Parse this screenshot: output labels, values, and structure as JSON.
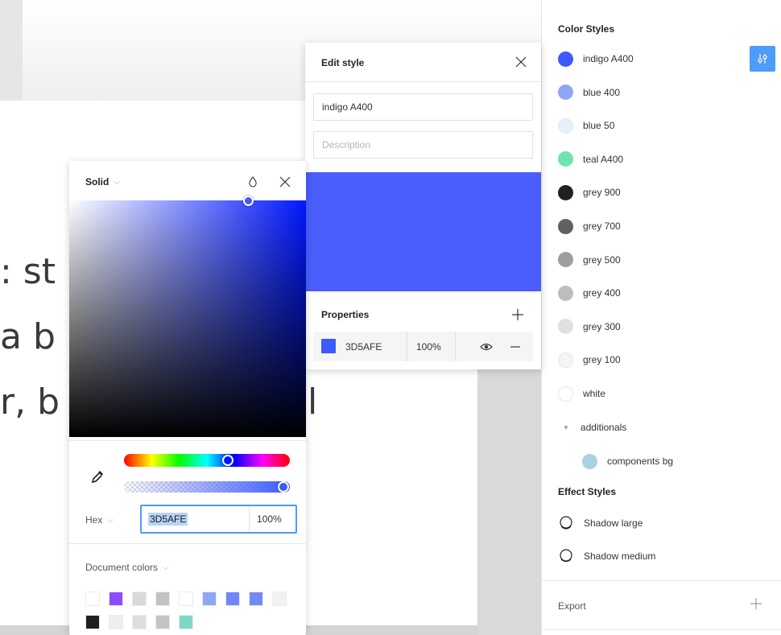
{
  "canvas": {
    "lines": [
      ": st",
      "a b",
      "r, b",
      "l"
    ]
  },
  "right_panel": {
    "color_styles_title": "Color Styles",
    "color_styles": [
      {
        "name": "indigo A400",
        "color": "#3d5afe"
      },
      {
        "name": "blue 400",
        "color": "#8ea6f6"
      },
      {
        "name": "blue 50",
        "color": "#e3f0fd"
      },
      {
        "name": "teal A400",
        "color": "#6fe3b0"
      },
      {
        "name": "grey 900",
        "color": "#212121"
      },
      {
        "name": "grey 700",
        "color": "#616161"
      },
      {
        "name": "grey 500",
        "color": "#9e9e9e"
      },
      {
        "name": "grey 400",
        "color": "#bdbdbd"
      },
      {
        "name": "grey 300",
        "color": "#e0e0e0"
      },
      {
        "name": "grey 100",
        "color": "#f5f5f5"
      },
      {
        "name": "white",
        "color": "#ffffff"
      }
    ],
    "group_label": "additionals",
    "group_items": [
      {
        "name": "components bg",
        "color": "#a8d2e0"
      }
    ],
    "effect_styles_title": "Effect Styles",
    "effect_styles": [
      {
        "name": "Shadow large"
      },
      {
        "name": "Shadow medium"
      }
    ],
    "export_label": "Export",
    "accent": "#4d9cf7"
  },
  "edit_style": {
    "title": "Edit style",
    "name_value": "indigo A400",
    "description_placeholder": "Description",
    "preview_color": "#4a5efb",
    "properties_title": "Properties",
    "fill_hex": "3D5AFE",
    "fill_opacity": "100%"
  },
  "picker": {
    "fill_type": "Solid",
    "hue": "#0018ff",
    "hex_label": "Hex",
    "hex_value": "3D5AFE",
    "opacity_value": "100%",
    "document_colors_label": "Document colors",
    "document_colors_row1": [
      "#ffffff",
      "#8b4dfc",
      "#d9d9d9",
      "#c2c2c2",
      "#ffffff",
      "#8ea6f6",
      "#6f86f5",
      "#7389f7",
      "#f2f2f2"
    ],
    "document_colors_row2": [
      "#1f1f1f",
      "#eeeeee",
      "#dedede",
      "#c4c4c4",
      "#7dd8c8"
    ]
  }
}
